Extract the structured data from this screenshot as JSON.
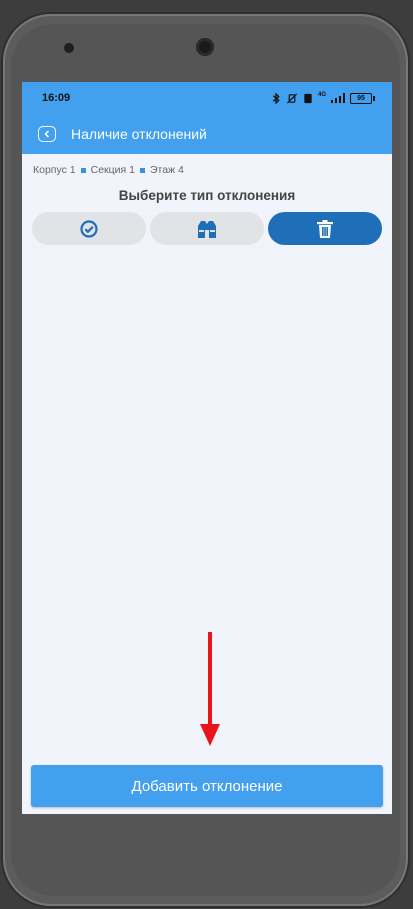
{
  "status": {
    "time": "16:09",
    "signal": "4G",
    "battery": "95"
  },
  "appbar": {
    "title": "Наличие отклонений"
  },
  "breadcrumb": {
    "building": "Корпус 1",
    "section": "Секция 1",
    "floor": "Этаж 4"
  },
  "main": {
    "title": "Выберите тип отклонения"
  },
  "types": [
    {
      "icon": "check-circle-icon",
      "active": false
    },
    {
      "icon": "vest-icon",
      "active": false
    },
    {
      "icon": "trash-icon",
      "active": true
    }
  ],
  "add_button": {
    "label": "Добавить отклонение"
  },
  "colors": {
    "primary": "#42a0ef",
    "active": "#1f6fb8",
    "annotation_arrow": "#e8141c"
  }
}
